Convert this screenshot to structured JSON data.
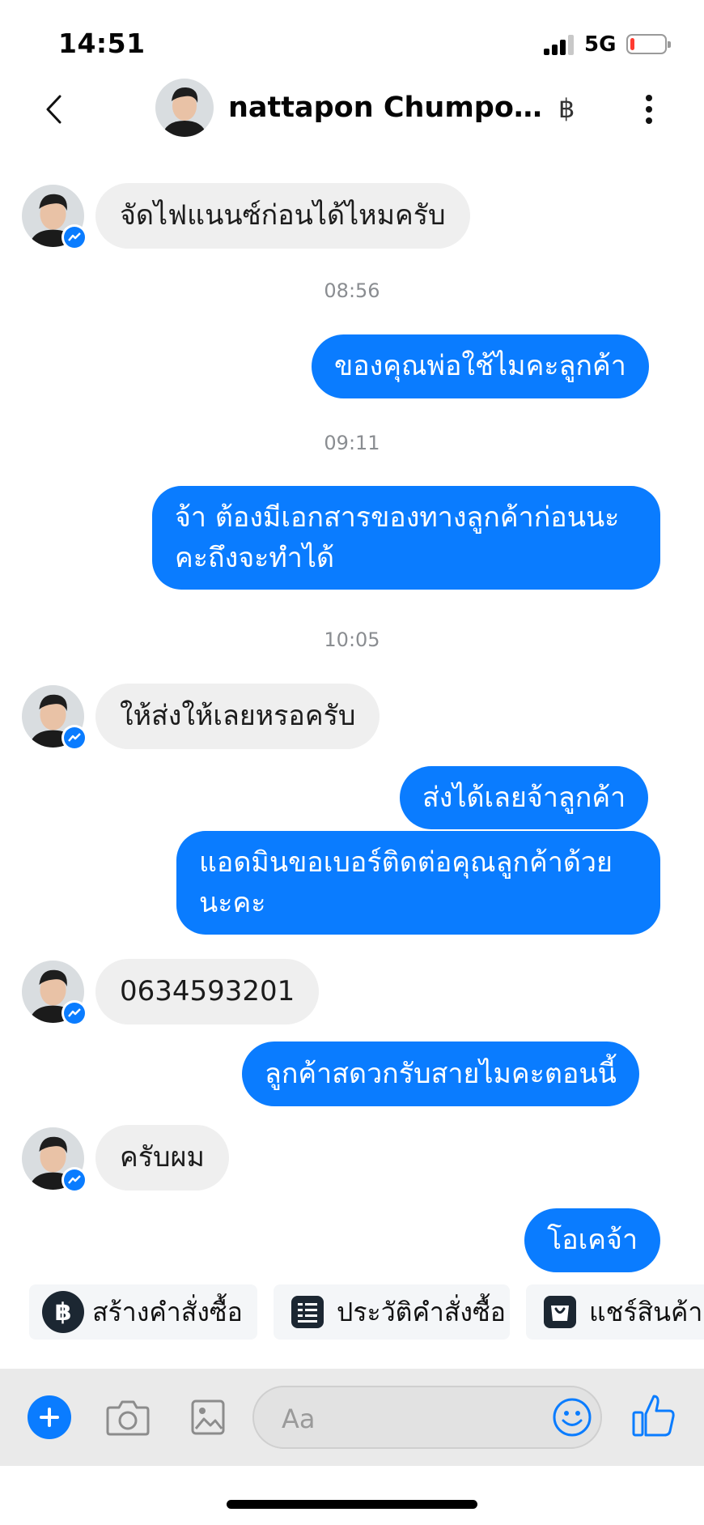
{
  "status_bar": {
    "time": "14:51",
    "network": "5G",
    "battery_level": 0.12
  },
  "header": {
    "contact_name": "nattapon Chumpon...",
    "currency_symbol": "฿"
  },
  "messages": [
    {
      "direction": "in",
      "text": "จัดไฟแนนซ์ก่อนได้ไหมครับ"
    },
    {
      "type": "timestamp",
      "text": "08:56"
    },
    {
      "direction": "out",
      "text": "ของคุณพ่อใช้ไมคะลูกค้า"
    },
    {
      "type": "timestamp",
      "text": "09:11"
    },
    {
      "direction": "out",
      "text": "จ้า ต้องมีเอกสารของทางลูกค้าก่อนนะ\nคะถึงจะทำได้"
    },
    {
      "type": "timestamp",
      "text": "10:05"
    },
    {
      "direction": "in",
      "text": "ให้ส่งให้เลยหรอครับ"
    },
    {
      "direction": "out",
      "text": "ส่งได้เลยจ้าลูกค้า"
    },
    {
      "direction": "out",
      "text": "แอดมินขอเบอร์ติดต่อคุณลูกค้าด้วย\nนะคะ"
    },
    {
      "direction": "in",
      "text": "0634593201"
    },
    {
      "direction": "out",
      "text": "ลูกค้าสดวกรับสายไมคะตอนนี้"
    },
    {
      "direction": "in",
      "text": "ครับผม"
    },
    {
      "direction": "out",
      "text": "โอเคจ้า"
    }
  ],
  "quick_actions": [
    {
      "label": "สร้างคำสั่งซื้อ",
      "icon": "baht-icon"
    },
    {
      "label": "ประวัติคำสั่งซื้อ",
      "icon": "order-list-icon"
    },
    {
      "label": "แชร์สินค้า",
      "icon": "shopping-bag-icon"
    }
  ],
  "composer": {
    "placeholder": "Aa"
  },
  "colors": {
    "accent": "#0a7cff",
    "incoming_bubble": "#efefef",
    "timestamp": "#8a8d91"
  }
}
